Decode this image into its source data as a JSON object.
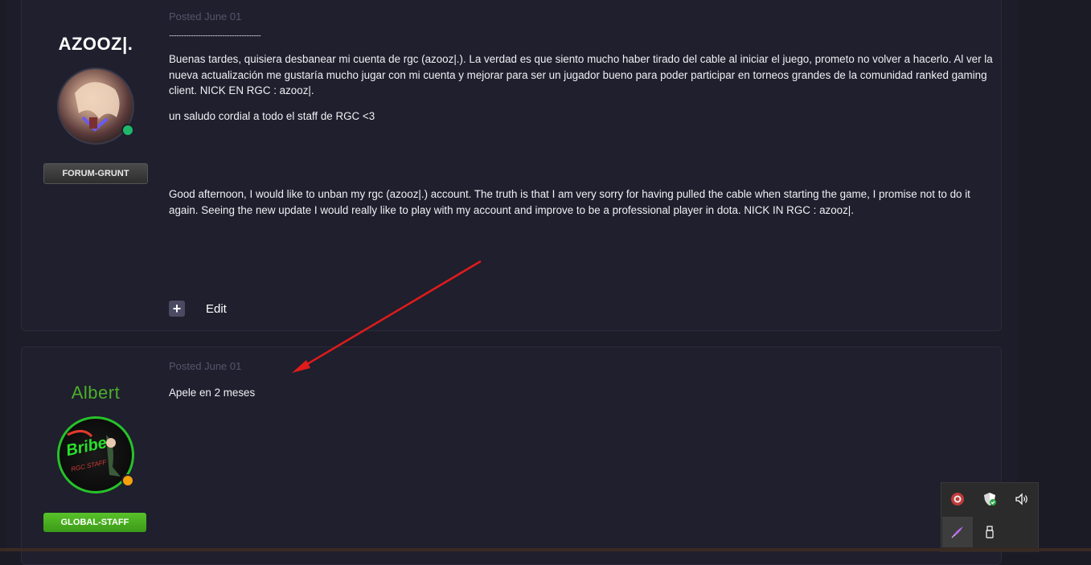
{
  "posts": [
    {
      "author": {
        "name": "AZOOZ|.",
        "rank": "FORUM-GRUNT",
        "name_color": "#ffffff"
      },
      "posted": "Posted June 01",
      "separator": "............................................................................",
      "paragraphs": [
        "Buenas tardes, quisiera desbanear mi cuenta de rgc (azooz|.). La verdad es que siento mucho haber tirado del cable al iniciar el juego, prometo no volver a hacerlo. Al ver la nueva actualización me gustaría mucho jugar con mi cuenta y mejorar para ser un jugador bueno para poder participar en torneos grandes de la comunidad ranked gaming client. NICK EN RGC : azooz|.",
        "un saludo cordial a todo el staff de RGC <3",
        "Good afternoon, I would like to unban my rgc (azooz|.) account. The truth is that I am very sorry for having pulled the cable when starting the game, I promise not to do it again. Seeing the new update I would really like to play with my account and improve to be a professional player in dota. NICK IN RGC : azooz|."
      ],
      "edit_label": "Edit"
    },
    {
      "author": {
        "name": "Albert",
        "rank": "GLOBAL-STAFF",
        "name_color": "#4caf2a",
        "avatar_text": "Bribe",
        "avatar_subtext": "RGC STAFF"
      },
      "posted": "Posted June 01",
      "paragraphs": [
        "Apele en 2 meses"
      ]
    }
  ],
  "colors": {
    "online_dot": "#1fb86a",
    "away_dot": "#f5a10a",
    "annotation_arrow": "#e01b1b",
    "staff_badge": "#4caf1e"
  },
  "tray_icons": [
    "record-icon",
    "shield-check-icon",
    "volume-icon",
    "pen-app-icon",
    "usb-icon"
  ]
}
